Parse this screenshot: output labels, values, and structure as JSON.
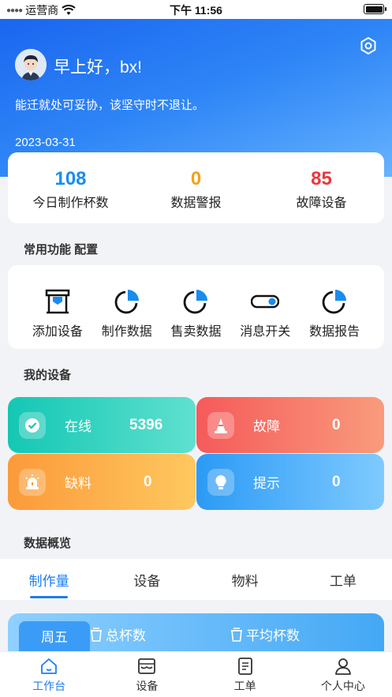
{
  "status_bar": {
    "carrier": "运营商",
    "time": "下午 11:56"
  },
  "header": {
    "greeting": "早上好，bx!",
    "motto": "能迁就处可妥协，该坚守时不退让。",
    "date": "2023-03-31"
  },
  "stats": [
    {
      "value": "108",
      "label": "今日制作杯数",
      "color": "#1a8cf0"
    },
    {
      "value": "0",
      "label": "数据警报",
      "color": "#f5a01c"
    },
    {
      "value": "85",
      "label": "故障设备",
      "color": "#e8383d"
    }
  ],
  "sections": {
    "common": "常用功能 配置",
    "devices": "我的设备",
    "overview": "数据概览"
  },
  "functions": [
    {
      "label": "添加设备",
      "icon": "device-box-icon"
    },
    {
      "label": "制作数据",
      "icon": "pie-chart-icon"
    },
    {
      "label": "售卖数据",
      "icon": "pie-chart-icon"
    },
    {
      "label": "消息开关",
      "icon": "toggle-icon"
    },
    {
      "label": "数据报告",
      "icon": "pie-chart-icon"
    }
  ],
  "devices": {
    "online": {
      "label": "在线",
      "value": "5396",
      "icon": "check-circle-icon"
    },
    "fault": {
      "label": "故障",
      "value": "0",
      "icon": "traffic-cone-icon"
    },
    "shortage": {
      "label": "缺料",
      "value": "0",
      "icon": "alarm-light-icon"
    },
    "tip": {
      "label": "提示",
      "value": "0",
      "icon": "lightbulb-icon"
    }
  },
  "tabs": [
    "制作量",
    "设备",
    "物料",
    "工单"
  ],
  "overview": {
    "day": "周五",
    "total_label": "总杯数",
    "avg_label": "平均杯数"
  },
  "nav": [
    "工作台",
    "设备",
    "工单",
    "个人中心"
  ],
  "colors": {
    "primary": "#1a7ff0",
    "background": "#f2f3f7"
  }
}
